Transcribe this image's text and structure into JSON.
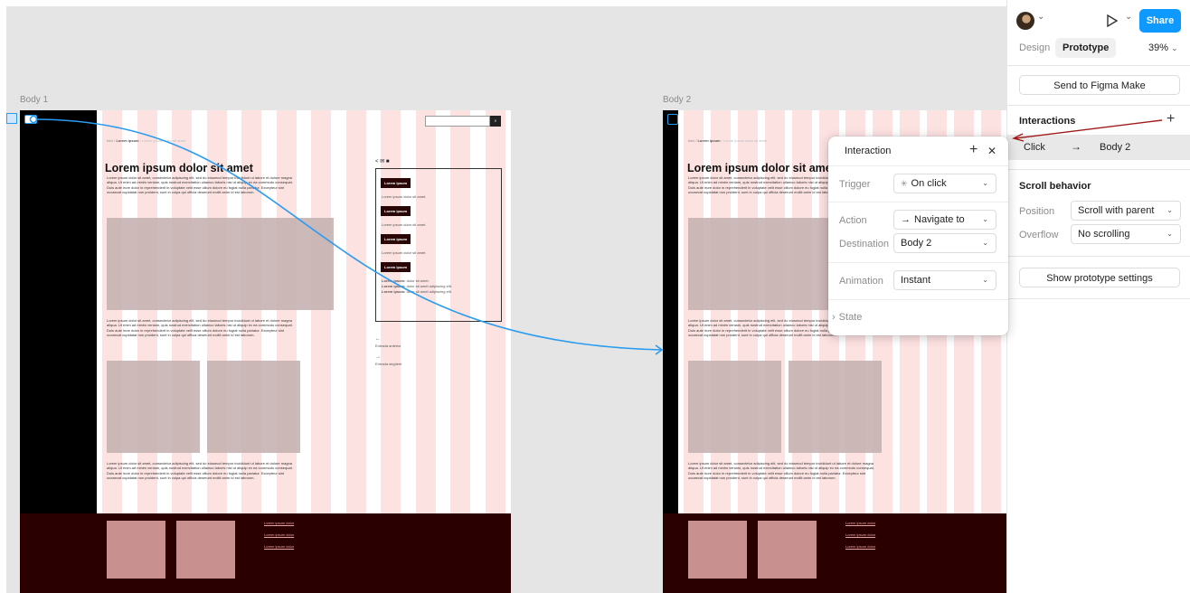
{
  "canvas": {
    "frame1_label": "Body 1",
    "frame2_label": "Body 2"
  },
  "page": {
    "breadcrumb_home": "Inici",
    "breadcrumb_sep": " / ",
    "breadcrumb_current": "Lorem ipsum",
    "breadcrumb_tail": " / Lorem ipsum dolor sit amet",
    "title": "Lorem ipsum dolor sit amet",
    "paragraph": "Lorem ipsum dolor sit amet, consectetur adipiscing elit, sed do eiusmod tempor incididunt ut labore et dolore magna aliqua. Ut enim ad minim veniam, quis nostrud exercitation ullamco laboris nisi ut aliquip ex ea commodo consequat. Duis aute irure dolor in reprehenderit in voluptate velit esse cillum dolore eu fugiat nulla pariatur. Excepteur sint occaecat cupidatat non proident, sunt in culpa qui officia deserunt mollit anim id est laborum.",
    "tag": "Lorem ipsum",
    "aside_line": "Lorem ipsum dolor sit amet.",
    "aside_strong": "Lorem ipsum:",
    "aside_strong_text1": " dolor sit amet.",
    "aside_strong_text2": " dolor sit amet adipiscing elit.",
    "prev_arrow": "←",
    "prev_label": "Entrada anterior",
    "next_arrow": "→",
    "next_label": "Entrada següent",
    "footer_link": "Lorem ipsum dolor"
  },
  "toolbar": {
    "share_label": "Share",
    "play_icon": "play-icon",
    "caret": "⌄"
  },
  "tabs": {
    "design": "Design",
    "prototype": "Prototype",
    "zoom": "39%"
  },
  "send_button": "Send to Figma Make",
  "interactions": {
    "header": "Interactions",
    "add": "+",
    "trigger": "Click",
    "arrow": "→",
    "destination": "Body 2"
  },
  "scroll": {
    "header": "Scroll behavior",
    "position_label": "Position",
    "position_value": "Scroll with parent",
    "overflow_label": "Overflow",
    "overflow_value": "No scrolling"
  },
  "settings_button": "Show prototype settings",
  "dialog": {
    "title": "Interaction",
    "add": "+",
    "close": "✕",
    "trigger_label": "Trigger",
    "trigger_value": "On click",
    "action_label": "Action",
    "action_value": "Navigate to",
    "action_arrow": "→",
    "destination_label": "Destination",
    "destination_value": "Body 2",
    "animation_label": "Animation",
    "animation_value": "Instant",
    "state_chevron": "›",
    "state_label": "State"
  },
  "colors": {
    "accent": "#0d99ff",
    "connector": "#2a9cf0",
    "annotation_arrow": "#a01a1a",
    "grid_column": "#fde2e2",
    "footer": "#2a0000"
  }
}
